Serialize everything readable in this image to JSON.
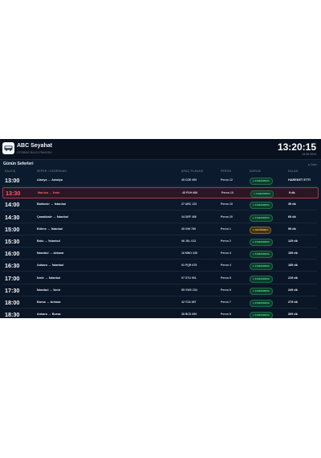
{
  "header": {
    "title": "ABC Seyahat",
    "subtitle": "OTOBÜS BİLGİ PANOSU",
    "clock": "13:20:15",
    "date": "14.06.2024"
  },
  "section": {
    "title": "Günün Seferleri",
    "note": "● Canlı"
  },
  "columns": [
    "KALKIŞ",
    "SEFER / GÜZERGAH",
    "ARAÇ PLAKASI",
    "PERON",
    "DURUM",
    "KALAN"
  ],
  "departures": [
    {
      "time": "13:00",
      "route": "Alanya → Antalya",
      "plate": "45 CDE 999",
      "gate": "Peron 12",
      "status": "ZAMANINDA",
      "status_type": "ontime",
      "remaining": "HAREKET ETTİ",
      "highlight": false
    },
    {
      "time": "13:30",
      "route": "Manisa → İzmir",
      "plate": "45 FGH 666",
      "gate": "Peron 10",
      "status": "ZAMANINDA",
      "status_type": "ontime",
      "remaining": "9 dk",
      "highlight": true
    },
    {
      "time": "14:00",
      "route": "Balıkesir → İstanbul",
      "plate": "27 ABC 123",
      "gate": "Peron 19",
      "status": "ZAMANINDA",
      "status_type": "ontime",
      "remaining": "39 dk",
      "highlight": false
    },
    {
      "time": "14:30",
      "route": "Çanakkale → İstanbul",
      "plate": "34 DEF 456",
      "gate": "Peron 20",
      "status": "ZAMANINDA",
      "status_type": "ontime",
      "remaining": "69 dk",
      "highlight": false
    },
    {
      "time": "15:00",
      "route": "Edirne → İstanbul",
      "plate": "35 GHI 789",
      "gate": "Peron 1",
      "status": "GECİKMELİ",
      "status_type": "late",
      "remaining": "99 dk",
      "highlight": false
    },
    {
      "time": "15:30",
      "route": "Bolu → İstanbul",
      "plate": "06 JKL 012",
      "gate": "Peron 2",
      "status": "ZAMANINDA",
      "status_type": "ontime",
      "remaining": "129 dk",
      "highlight": false
    },
    {
      "time": "16:00",
      "route": "İstanbul → Ankara",
      "plate": "16 MNO 345",
      "gate": "Peron 3",
      "status": "ZAMANINDA",
      "status_type": "ontime",
      "remaining": "159 dk",
      "highlight": false
    },
    {
      "time": "16:30",
      "route": "Ankara → İstanbul",
      "plate": "01 PQR 678",
      "gate": "Peron 4",
      "status": "ZAMANINDA",
      "status_type": "ontime",
      "remaining": "189 dk",
      "highlight": false
    },
    {
      "time": "17:00",
      "route": "İzmir → İstanbul",
      "plate": "07 STU 901",
      "gate": "Peron 5",
      "status": "ZAMANINDA",
      "status_type": "ontime",
      "remaining": "219 dk",
      "highlight": false
    },
    {
      "time": "17:30",
      "route": "İstanbul → İzmir",
      "plate": "55 VWX 234",
      "gate": "Peron 6",
      "status": "ZAMANINDA",
      "status_type": "ontime",
      "remaining": "249 dk",
      "highlight": false
    },
    {
      "time": "18:00",
      "route": "Bursa → Ankara",
      "plate": "42 YZA 567",
      "gate": "Peron 7",
      "status": "ZAMANINDA",
      "status_type": "ontime",
      "remaining": "279 dk",
      "highlight": false
    },
    {
      "time": "18:30",
      "route": "Ankara → Bursa",
      "plate": "38 BCD 890",
      "gate": "Peron 8",
      "status": "ZAMANINDA",
      "status_type": "ontime",
      "remaining": "309 dk",
      "highlight": false
    }
  ],
  "colors": {
    "background": "#0a1728",
    "ontime": "#4fe08d",
    "late": "#f3c948",
    "delayed_row": "#ff5b6b"
  }
}
